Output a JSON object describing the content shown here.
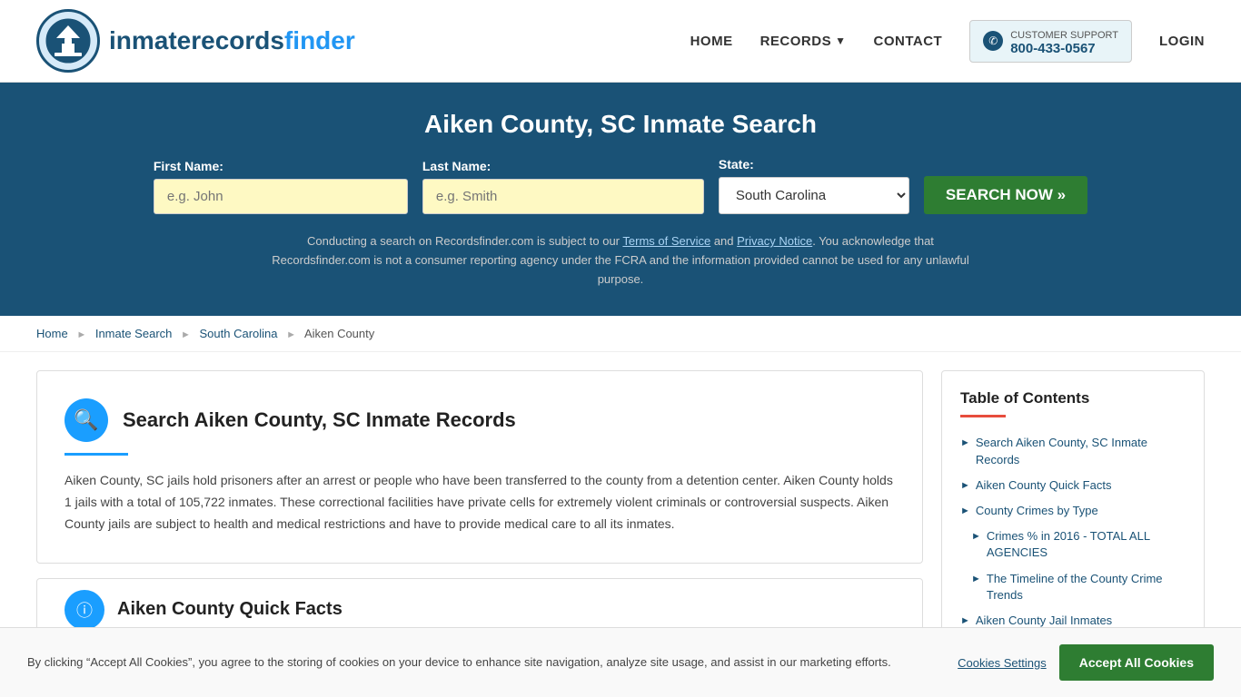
{
  "header": {
    "logo_text_main": "inmaterecords",
    "logo_text_bold": "finder",
    "nav": {
      "home": "HOME",
      "records": "RECORDS",
      "contact": "CONTACT",
      "login": "LOGIN",
      "support_label": "CUSTOMER SUPPORT",
      "support_phone": "800-433-0567"
    }
  },
  "hero": {
    "title": "Aiken County, SC Inmate Search",
    "first_name_label": "First Name:",
    "first_name_placeholder": "e.g. John",
    "last_name_label": "Last Name:",
    "last_name_placeholder": "e.g. Smith",
    "state_label": "State:",
    "state_value": "South Carolina",
    "search_button": "SEARCH NOW »",
    "disclaimer": "Conducting a search on Recordsfinder.com is subject to our Terms of Service and Privacy Notice. You acknowledge that Recordsfinder.com is not a consumer reporting agency under the FCRA and the information provided cannot be used for any unlawful purpose."
  },
  "breadcrumb": {
    "home": "Home",
    "inmate_search": "Inmate Search",
    "state": "South Carolina",
    "county": "Aiken County"
  },
  "main": {
    "section1": {
      "title": "Search Aiken County, SC Inmate Records",
      "body": "Aiken County, SC jails hold prisoners after an arrest or people who have been transferred to the county from a detention center. Aiken County holds 1 jails with a total of 105,722 inmates. These correctional facilities have private cells for extremely violent criminals or controversial suspects. Aiken County jails are subject to health and medical restrictions and have to provide medical care to all its inmates."
    },
    "section2_title": "Aiken County Quick Facts"
  },
  "toc": {
    "title": "Table of Contents",
    "items": [
      {
        "label": "Search Aiken County, SC Inmate Records",
        "sub": false
      },
      {
        "label": "Aiken County Quick Facts",
        "sub": false
      },
      {
        "label": "County Crimes by Type",
        "sub": false
      },
      {
        "label": "Crimes % in 2016 - TOTAL ALL AGENCIES",
        "sub": true
      },
      {
        "label": "The Timeline of the County Crime Trends",
        "sub": true
      },
      {
        "label": "Aiken County Jail Inmates",
        "sub": false
      }
    ]
  },
  "cookie": {
    "text": "By clicking “Accept All Cookies”, you agree to the storing of cookies on your device to enhance site navigation, analyze site usage, and assist in our marketing efforts.",
    "settings_label": "Cookies Settings",
    "accept_label": "Accept All Cookies"
  }
}
